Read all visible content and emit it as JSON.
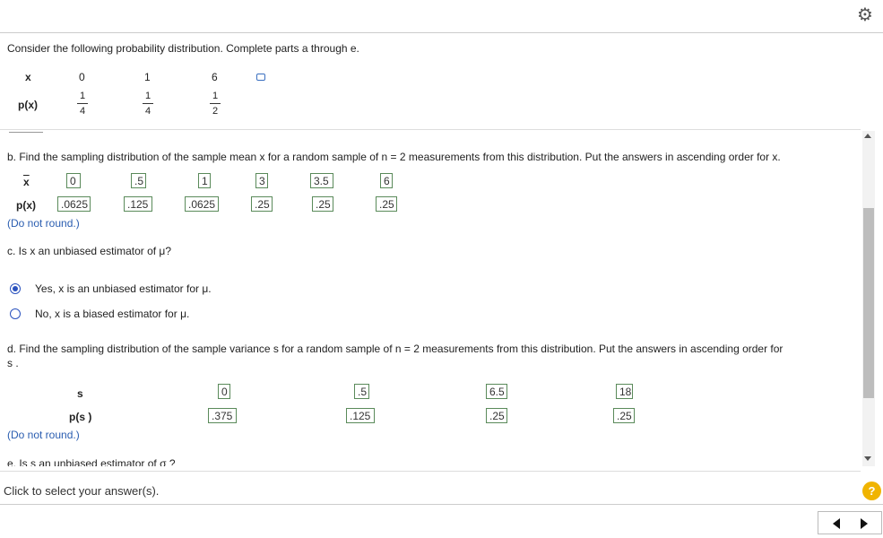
{
  "prompt": "Consider the following probability distribution. Complete parts a through e.",
  "prompt_bold": "a",
  "prompt_bold2": "e.",
  "dist": {
    "x_label": "x",
    "px_label": "p(x)",
    "x_values": [
      "0",
      "1",
      "6"
    ],
    "p_num": [
      "1",
      "1",
      "1"
    ],
    "p_den": [
      "4",
      "4",
      "2"
    ]
  },
  "part_b": {
    "text": "b. Find the sampling distribution of the sample mean x for a random sample of n = 2  measurements from this distribution. Put the answers in ascending order for x.",
    "xbar_label": "x",
    "pxbar_label": "p(x)",
    "xbar_values": [
      "0",
      ".5",
      "1",
      "3",
      "3.5",
      "6"
    ],
    "p_values": [
      ".0625",
      ".125",
      ".0625",
      ".25",
      ".25",
      ".25"
    ],
    "note": "(Do not round.)"
  },
  "part_c": {
    "question": "c. Is x an unbiased estimator of μ?",
    "option_yes": "Yes, x is an unbiased estimator for μ.",
    "option_no": "No, x is a biased estimator for μ.",
    "selected": "yes"
  },
  "part_d": {
    "text_line1": "d. Find the sampling distribution of the sample variance s  for a random sample of n = 2 measurements from this distribution. Put the answers in ascending order for",
    "text_line2": "s .",
    "s2_label": "s",
    "ps2_label": "p(s )",
    "s2_values": [
      "0",
      ".5",
      "6.5",
      "18"
    ],
    "p_values": [
      ".375",
      ".125",
      ".25",
      ".25"
    ],
    "note": "(Do not round.)"
  },
  "part_e_partial": "e. Is s  an unbiased estimator of σ ?",
  "footer": {
    "hint": "Click to select your answer(s)."
  },
  "icons": {
    "settings": "gear-icon",
    "help": "help-icon",
    "prev": "prev-arrow-icon",
    "next": "next-arrow-icon",
    "collapse": "collapse-icon"
  },
  "colors": {
    "accent": "#2a52be",
    "box_border": "#5a8a5a",
    "help": "#f0b400"
  }
}
